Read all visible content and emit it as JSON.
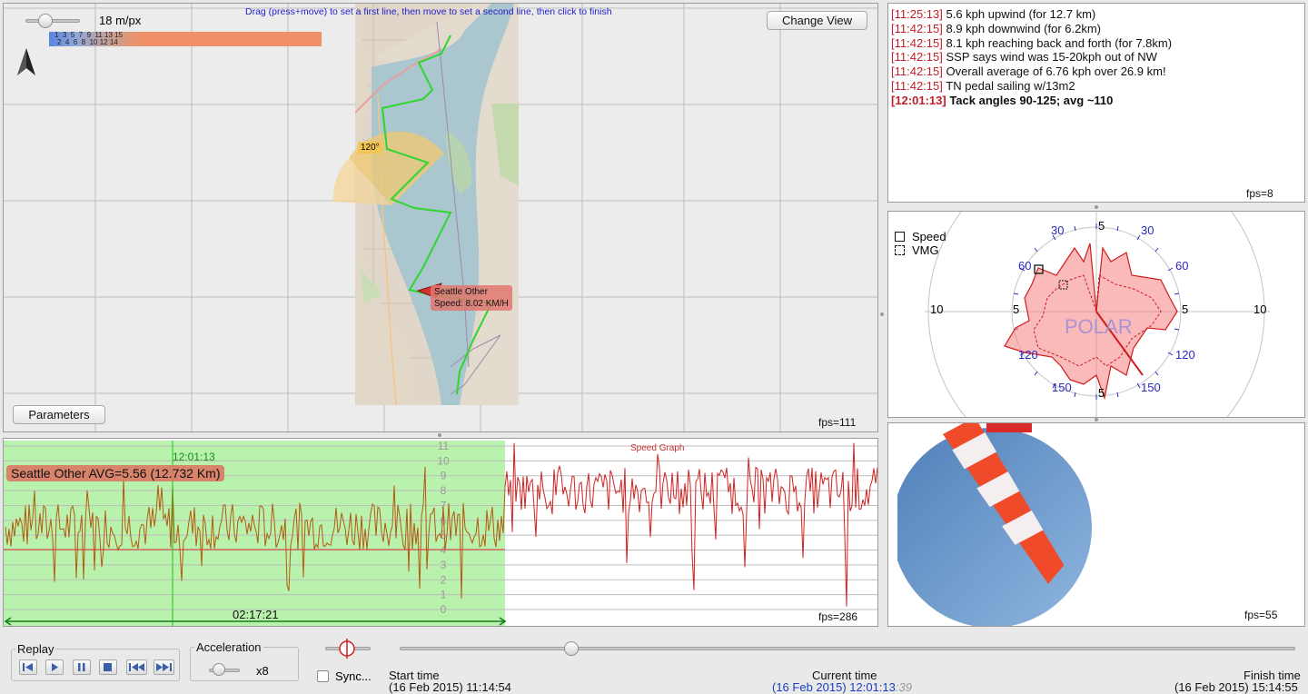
{
  "map": {
    "scale_label": "18 m/px",
    "instruction": "Drag (press+move) to set a first line, then move to set a second line, then click to finish",
    "change_view_label": "Change View",
    "parameters_label": "Parameters",
    "fps": "fps=111",
    "angle_label": "120°",
    "boat_name": "Seattle Other",
    "boat_speed": "Speed: 8.02 KM/H",
    "legend_top": "1  3  5  7  9  11 13 15",
    "legend_bottom": "2  4  6  8  10 12 14",
    "accent_color": "#f0906a"
  },
  "graph": {
    "title": "Speed Graph",
    "avg_label": "Seattle Other AVG=5.56 (12.732 Km)",
    "cursor_time": "12:01:13",
    "selection_duration": "02:17:21",
    "fps": "fps=286",
    "y_ticks": [
      "0",
      "1",
      "2",
      "3",
      "4",
      "5",
      "6",
      "7",
      "8",
      "9",
      "10",
      "11"
    ],
    "avg_value": 5.56,
    "line_color": "#d42020"
  },
  "chat": {
    "lines": [
      {
        "time": "[11:25:13]",
        "text": "  5.6 kph upwind (for 12.7 km)",
        "bold": false
      },
      {
        "time": "[11:42:15]",
        "text": " 8.9 kph downwind (for 6.2km)",
        "bold": false
      },
      {
        "time": "[11:42:15]",
        "text": " 8.1 kph reaching back and forth (for 7.8km)",
        "bold": false
      },
      {
        "time": "[11:42:15]",
        "text": " SSP says wind was 15-20kph out of NW",
        "bold": false
      },
      {
        "time": "[11:42:15]",
        "text": " Overall average of 6.76 kph over 26.9 km!",
        "bold": false
      },
      {
        "time": "[11:42:15]",
        "text": " TN pedal sailing w/13m2",
        "bold": false
      },
      {
        "time": "[12:01:13]",
        "text": " Tack angles 90-125; avg ~110",
        "bold": true
      }
    ],
    "fps": "fps=8"
  },
  "polar": {
    "legend_speed": "Speed",
    "legend_vmg": "VMG",
    "watermark": "POLAR",
    "angle_labels": [
      "30",
      "30",
      "60",
      "60",
      "120",
      "120",
      "150",
      "150"
    ],
    "radius_labels": [
      "5",
      "5",
      "5",
      "5",
      "10",
      "10"
    ]
  },
  "windsock": {
    "fps": "fps=55"
  },
  "controls": {
    "replay_label": "Replay",
    "acceleration_label": "Acceleration",
    "acceleration_value": "x8",
    "sync_label": "Sync...",
    "start_title": "Start time",
    "start_value": "(16 Feb 2015) 11:14:54",
    "current_title": "Current time",
    "current_value": "(16 Feb 2015) 12:01:13",
    "current_seconds": ":39",
    "finish_title": "Finish time",
    "finish_value": "(16 Feb 2015) 15:14:55",
    "timeline_position": 0.192
  },
  "chart_data": {
    "type": "line",
    "title": "Speed Graph",
    "xlabel": "",
    "ylabel": "",
    "ylim": [
      0,
      11
    ],
    "series": [
      {
        "name": "Seattle Other",
        "avg": 5.56
      }
    ]
  }
}
